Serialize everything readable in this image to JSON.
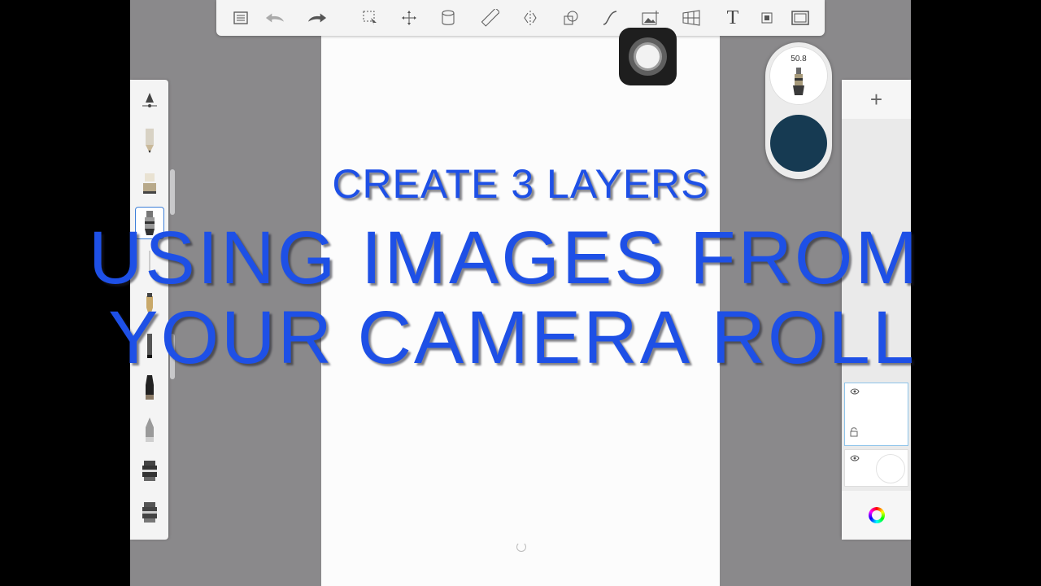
{
  "toolbar": {
    "icons": [
      "list-icon",
      "undo-icon",
      "redo-icon",
      "selection-icon",
      "transform-icon",
      "fill-icon",
      "ruler-icon",
      "symmetry-icon",
      "shape-icon",
      "curve-icon",
      "import-image-icon",
      "perspective-icon",
      "text-icon",
      "record-icon",
      "fullscreen-icon"
    ],
    "text_tool_label": "T"
  },
  "brush_puck": {
    "size_value": "50.8",
    "color": "#163a52"
  },
  "layer_panel": {
    "add_label": "+",
    "layers": [
      {
        "name": "layer-1",
        "visible": true,
        "selected": true
      },
      {
        "name": "layer-2",
        "visible": true,
        "selected": false
      }
    ]
  },
  "captions": {
    "line1": "CREATE 3 LAYERS",
    "line2": "USING IMAGES FROM",
    "line3": "YOUR CAMERA ROLL",
    "color": "#1e50e6"
  }
}
